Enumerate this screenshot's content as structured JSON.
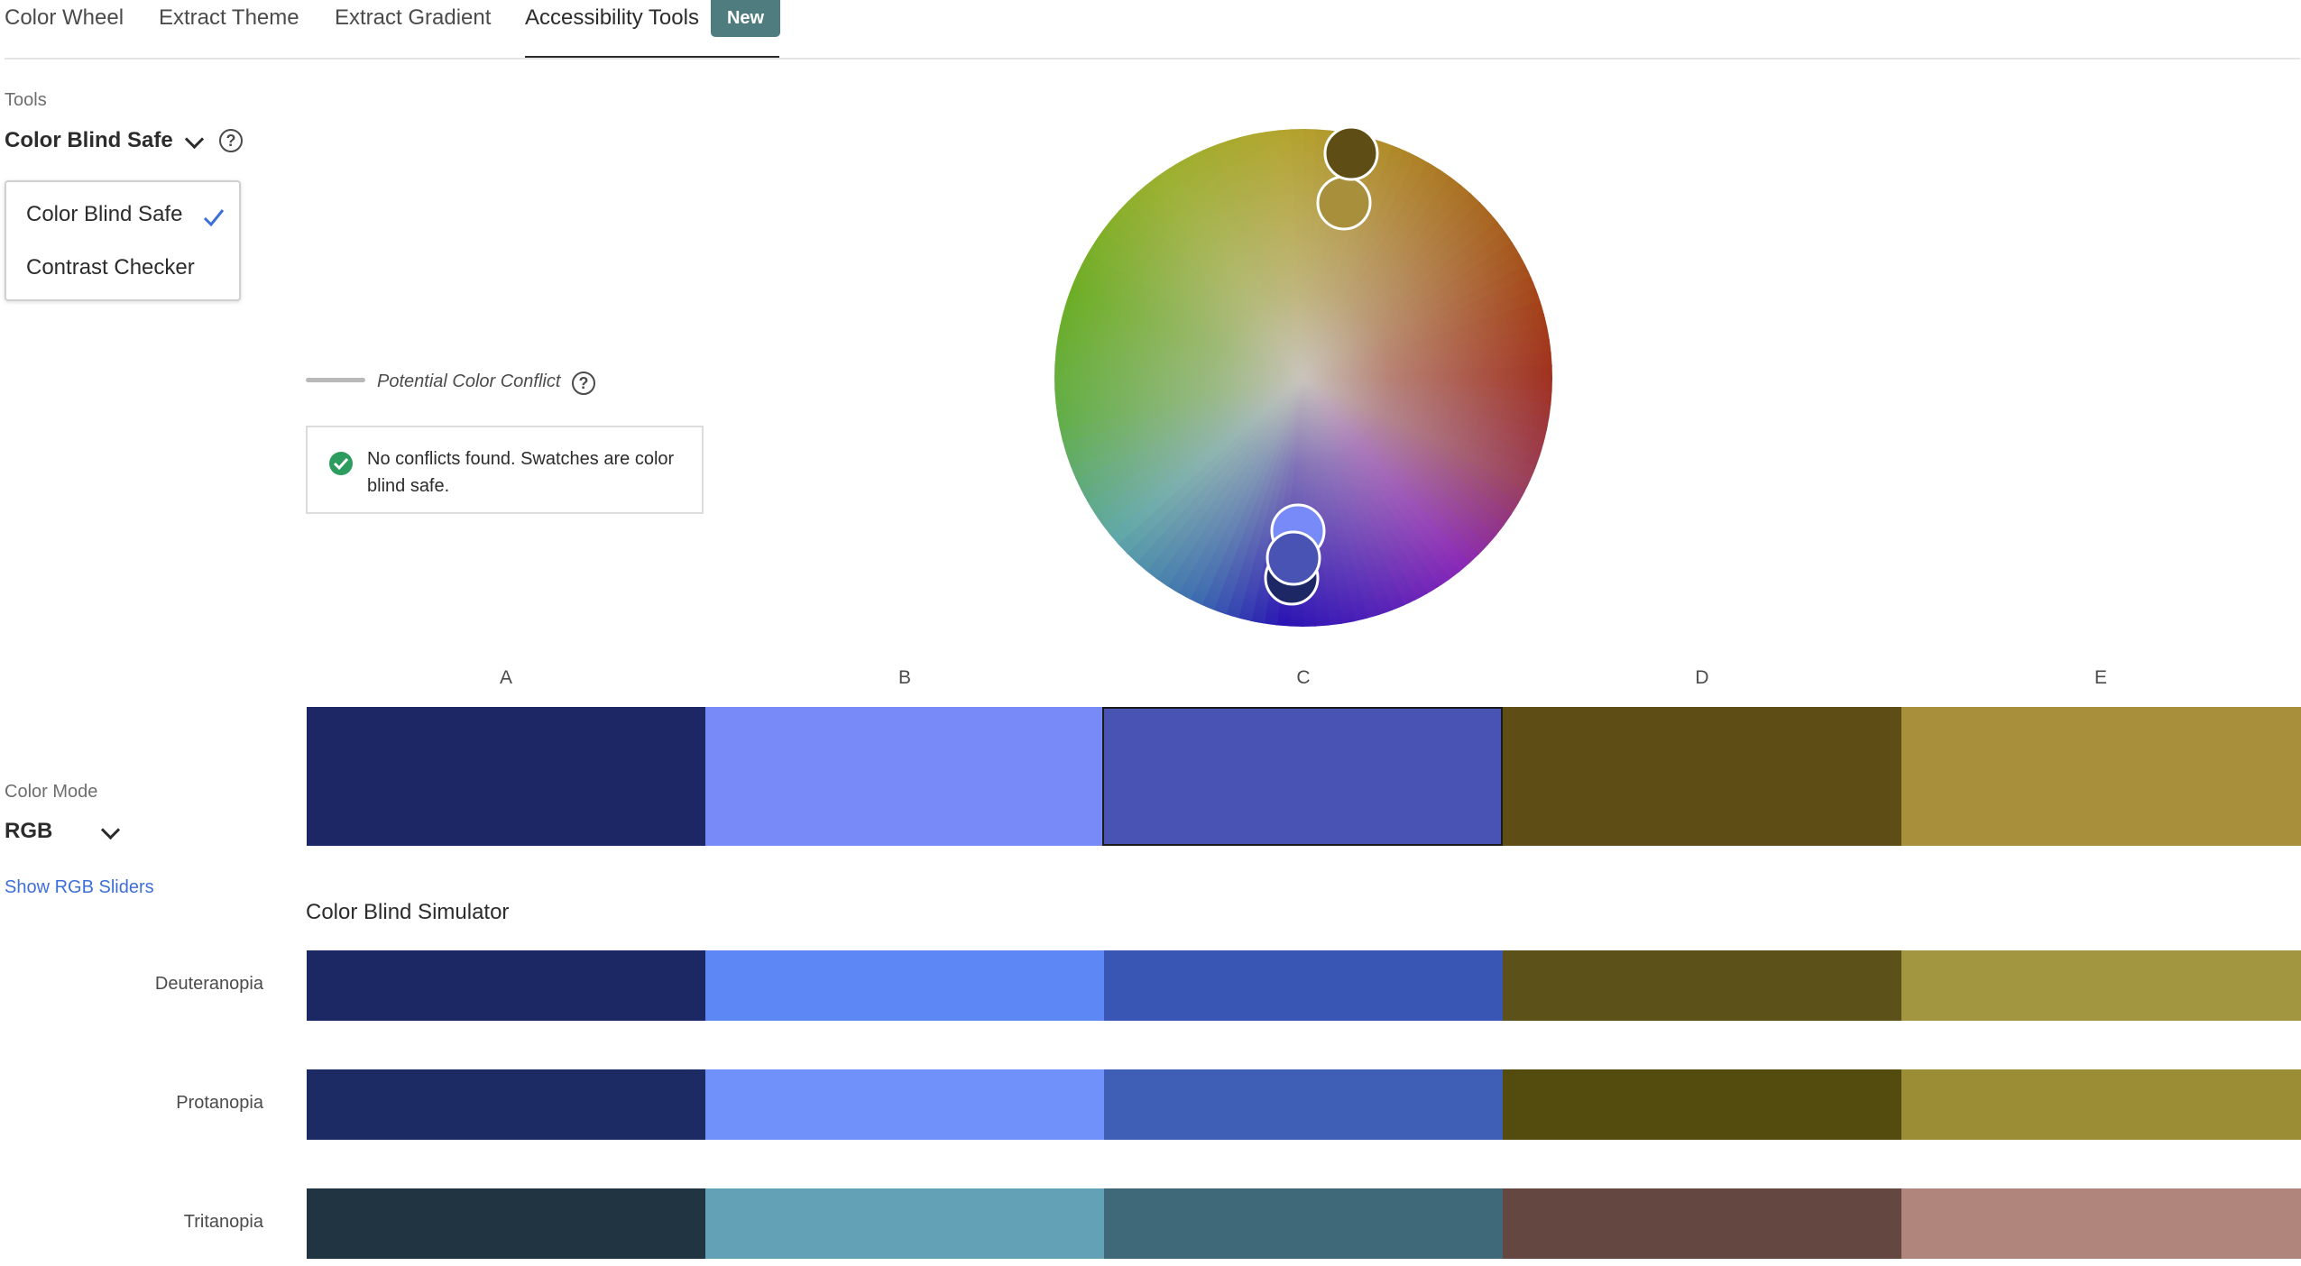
{
  "tabs": [
    {
      "label": "Color Wheel"
    },
    {
      "label": "Extract Theme"
    },
    {
      "label": "Extract Gradient"
    },
    {
      "label": "Accessibility Tools"
    }
  ],
  "badge_new": "New",
  "tools": {
    "label": "Tools",
    "selected": "Color Blind Safe",
    "menu": [
      {
        "label": "Color Blind Safe",
        "checked": true
      },
      {
        "label": "Contrast Checker",
        "checked": false
      }
    ]
  },
  "conflict": {
    "legend_label": "Potential Color Conflict",
    "message": "No conflicts found. Swatches are color blind safe."
  },
  "swatches": {
    "headers": [
      "A",
      "B",
      "C",
      "D",
      "E"
    ],
    "colors": [
      "#1e2766",
      "#7889f8",
      "#4853b4",
      "#5f4d16",
      "#a78f3c"
    ],
    "selected_index": 2
  },
  "color_mode": {
    "label": "Color Mode",
    "value": "RGB",
    "link": "Show RGB Sliders"
  },
  "simulator": {
    "title": "Color Blind Simulator",
    "rows": [
      {
        "label": "Deuteranopia",
        "colors": [
          "#1c2863",
          "#5e87f6",
          "#3956b4",
          "#5c5219",
          "#a39640"
        ]
      },
      {
        "label": "Protanopia",
        "colors": [
          "#1d2b64",
          "#6f91f9",
          "#3e5fb5",
          "#544c0f",
          "#9b8d35"
        ]
      },
      {
        "label": "Tritanopia",
        "colors": [
          "#203541",
          "#63a2b6",
          "#3f6879",
          "#654742",
          "#b0857b"
        ]
      }
    ]
  },
  "wheel": {
    "handles": [
      {
        "color": "#5f4d16"
      },
      {
        "color": "#a78f3c"
      },
      {
        "color": "#7889f8"
      },
      {
        "color": "#4853b4"
      },
      {
        "color": "#1e2766"
      }
    ]
  }
}
